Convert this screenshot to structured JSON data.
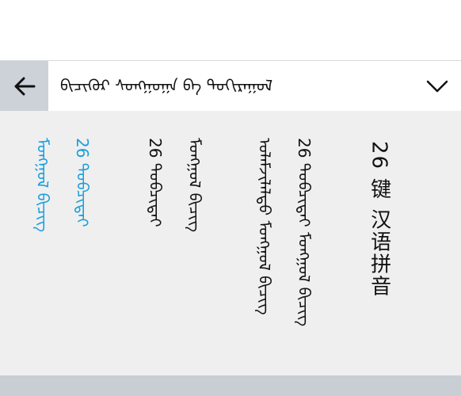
{
  "header": {
    "title": "ᠪᠢᠴᠢᠭᠦᠷ ᠰᠤᠩᠭᠤᠭᠠ ᠪᠠ ᠲᠣᠬᠢᠷᠠᠭᠤᠯ",
    "back_icon": "arrow-left-icon",
    "dropdown_icon": "chevron-down-icon"
  },
  "keyboard_options": [
    {
      "label": "26 键 汉语拼音",
      "selected": false
    },
    {
      "label": "26 ᠲᠤᠪᠴᠢᠲᠠᠢ ᠮᠣᠩᠭᠣᠯ ᠪᠢᠴᠢᠭ᠌",
      "selected": false
    },
    {
      "label": "ᠤᠯᠠᠮᠵᠢᠯᠠᠯᠲᠤ ᠮᠣᠩᠭᠣᠯ ᠪᠢᠴᠢᠭ᠌",
      "selected": false
    },
    {
      "label": "ᠮᠣᠩᠭᠣᠯ ᠪᠢᠴᠢᠭ᠌",
      "selected": false
    },
    {
      "label": "26 ᠲᠤᠪᠴᠢᠲᠠᠢ",
      "selected": true
    },
    {
      "label": "ᠮᠣᠩᠭᠣᠯ ᠪᠢᠴᠢᠭ᠌",
      "selected": true
    }
  ],
  "colors": {
    "selected": "#1a9fdc",
    "back_button_bg": "#ccd2d8",
    "options_bg": "#efefef"
  }
}
